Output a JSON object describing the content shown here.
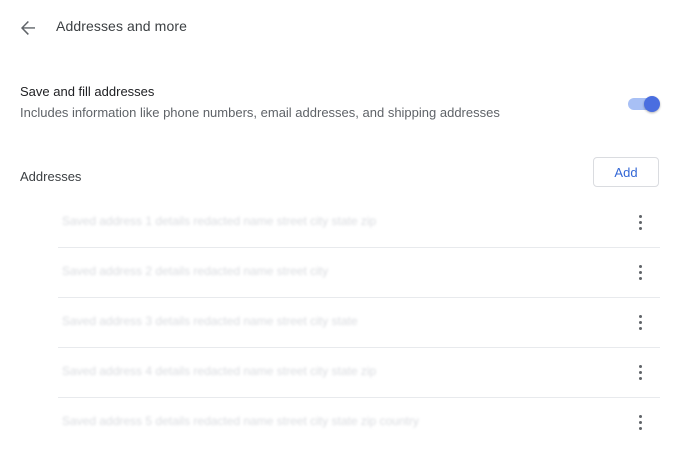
{
  "header": {
    "title": "Addresses and more",
    "back_icon": "arrow-back-icon"
  },
  "setting": {
    "title": "Save and fill addresses",
    "description": "Includes information like phone numbers, email addresses, and shipping addresses",
    "toggle_state": true,
    "accent_color": "#4a6ee0"
  },
  "addresses": {
    "section_title": "Addresses",
    "add_label": "Add",
    "items": [
      {
        "summary": "Saved address 1 details redacted name street city state zip"
      },
      {
        "summary": "Saved address 2 details redacted name street city"
      },
      {
        "summary": "Saved address 3 details redacted name street city state"
      },
      {
        "summary": "Saved address 4 details redacted name street city state zip"
      },
      {
        "summary": "Saved address 5 details redacted name street city state zip country"
      }
    ],
    "more_icon": "more-vert-icon"
  }
}
